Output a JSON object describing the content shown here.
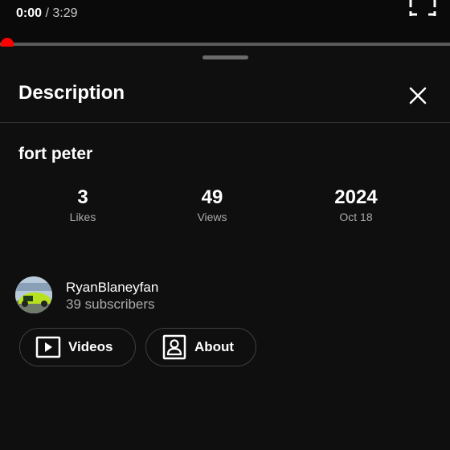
{
  "player": {
    "current_time": "0:00",
    "separator": "/",
    "duration": "3:29",
    "progress_fraction": 0.0
  },
  "description_panel": {
    "title": "Description",
    "video_title": "fort peter",
    "stats": [
      {
        "value": "3",
        "label": "Likes"
      },
      {
        "value": "49",
        "label": "Views"
      },
      {
        "value": "2024",
        "label": "Oct 18"
      }
    ],
    "channel": {
      "name": "RyanBlaneyfan",
      "subscribers": "39 subscribers"
    },
    "buttons": {
      "videos": "Videos",
      "about": "About"
    }
  },
  "colors": {
    "accent": "#ff0000",
    "background": "#0f0f0f",
    "secondary_text": "#aaaaaa"
  },
  "icons": [
    "fullscreen-icon",
    "close-icon",
    "play-box-icon",
    "person-box-icon"
  ]
}
